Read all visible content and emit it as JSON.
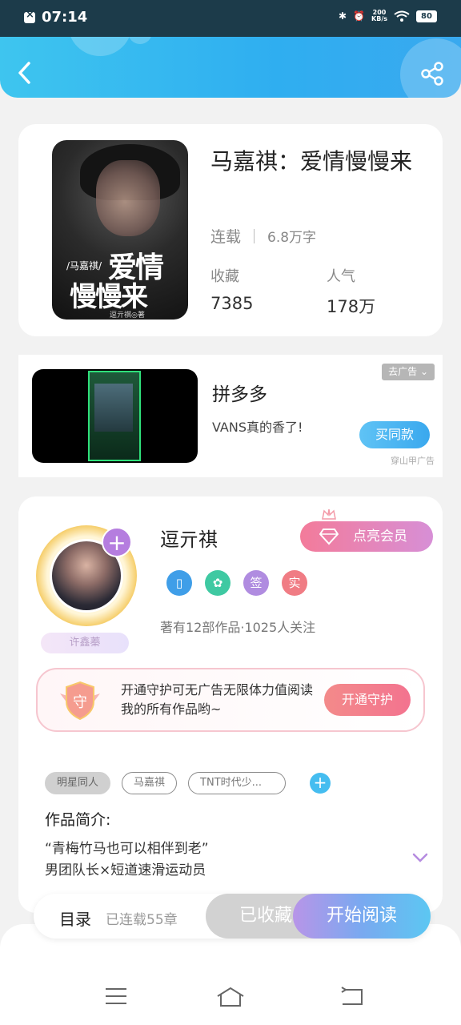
{
  "status_bar": {
    "time": "07:14",
    "net_speed": "200",
    "net_unit": "KB/s",
    "battery": "80",
    "icons": [
      "app-x-icon",
      "bluetooth-icon",
      "alarm-icon",
      "wifi-icon",
      "battery-icon"
    ]
  },
  "header": {
    "back_icon": "back-arrow-icon",
    "share_icon": "share-icon",
    "background_color": "#2faef0"
  },
  "book": {
    "cover": {
      "tag": "/马嘉祺/",
      "title_line1": "爱情",
      "title_line2": "慢慢来",
      "author": "逗亓祺◎著"
    },
    "title": "马嘉祺：爱情慢慢来",
    "status": "连载",
    "word_count": "6.8万字",
    "favorites_label": "收藏",
    "favorites_value": "7385",
    "popularity_label": "人气",
    "popularity_value": "178万"
  },
  "ad": {
    "title": "拼多多",
    "description": "VANS真的香了!",
    "close_label": "去广告",
    "buy_label": "买同款",
    "source": "穿山甲广告"
  },
  "author": {
    "name": "逗亓祺",
    "avatar_tag": "许鑫蓁",
    "vip_label": "点亮会员",
    "badges": [
      {
        "icon": "phone-badge-icon",
        "text": "",
        "color": "#3f9ee8"
      },
      {
        "icon": "handshake-badge-icon",
        "text": "",
        "color": "#3fc9a2"
      },
      {
        "icon": "sign-badge-icon",
        "text": "签",
        "color": "#b08ce0"
      },
      {
        "icon": "verified-badge-icon",
        "text": "实",
        "color": "#f07c84"
      }
    ],
    "stats": "著有12部作品·1025人关注",
    "guard_text": "开通守护可无广告无限体力值阅读我的所有作品哟~",
    "guard_icon_text": "守",
    "guard_button": "开通守护"
  },
  "tags": [
    "明星同人",
    "马嘉祺",
    "TNT时代少..."
  ],
  "intro": {
    "title": "作品简介:",
    "line1": "“青梅竹马也可以相伴到老”",
    "line2": "男团队长×短道速滑运动员"
  },
  "actions": {
    "toc_label": "目录",
    "chapters": "已连载55章",
    "collected_label": "已收藏",
    "read_label": "开始阅读"
  },
  "nav": {
    "icons": [
      "menu-icon",
      "home-icon",
      "back-nav-icon"
    ]
  }
}
